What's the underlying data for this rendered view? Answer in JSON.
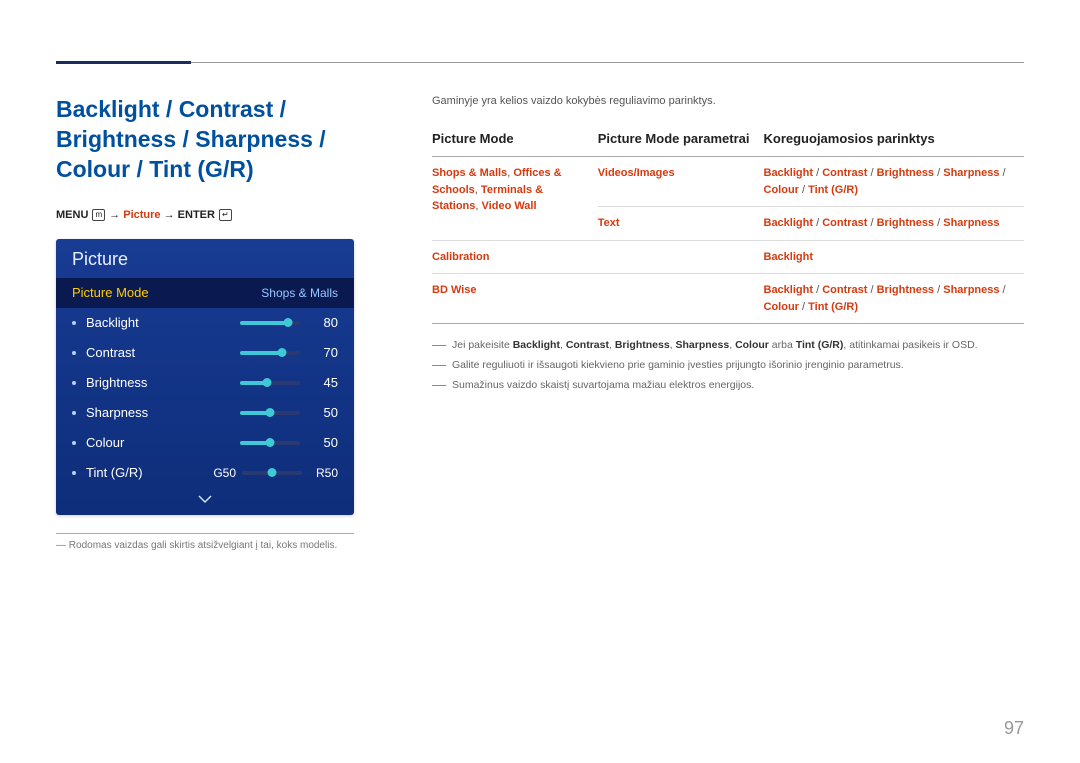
{
  "page_number": "97",
  "main_title": "Backlight / Contrast / Brightness / Sharpness / Colour / Tint (G/R)",
  "menu_path": {
    "prefix": "MENU",
    "mid": "Picture",
    "suffix": "ENTER"
  },
  "osd": {
    "title": "Picture",
    "highlight_label": "Picture Mode",
    "highlight_value": "Shops & Malls",
    "rows": [
      {
        "label": "Backlight",
        "value": "80",
        "pct": 80
      },
      {
        "label": "Contrast",
        "value": "70",
        "pct": 70
      },
      {
        "label": "Brightness",
        "value": "45",
        "pct": 45
      },
      {
        "label": "Sharpness",
        "value": "50",
        "pct": 50
      },
      {
        "label": "Colour",
        "value": "50",
        "pct": 50
      }
    ],
    "tint": {
      "label": "Tint (G/R)",
      "g": "G50",
      "r": "R50"
    }
  },
  "left_footnote": "Rodomas vaizdas gali skirtis atsižvelgiant į tai, koks modelis.",
  "intro": "Gaminyje yra kelios vaizdo kokybės reguliavimo parinktys.",
  "table": {
    "headers": {
      "mode": "Picture Mode",
      "param": "Picture Mode parametrai",
      "adj": "Koreguojamosios parinktys"
    },
    "rows": [
      {
        "mode_parts": [
          "Shops & Malls",
          ", ",
          "Offices & Schools",
          ", ",
          "Terminals & Stations",
          ", ",
          "Video Wall"
        ],
        "param_parts": [
          "Videos/Images"
        ],
        "adj_parts": [
          "Backlight",
          " / ",
          "Contrast",
          " / ",
          "Brightness",
          " / ",
          "Sharpness",
          " / ",
          "Colour",
          " / ",
          "Tint (G/R)"
        ]
      },
      {
        "mode_parts": [],
        "param_parts": [
          "Text"
        ],
        "adj_parts": [
          "Backlight",
          " / ",
          "Contrast",
          " / ",
          "Brightness",
          " / ",
          "Sharpness"
        ]
      },
      {
        "mode_parts": [
          "Calibration"
        ],
        "param_parts": [],
        "adj_parts": [
          "Backlight"
        ]
      },
      {
        "mode_parts": [
          "BD Wise"
        ],
        "param_parts": [],
        "adj_parts": [
          "Backlight",
          " / ",
          "Contrast",
          " / ",
          "Brightness",
          " / ",
          "Sharpness",
          " / ",
          "Colour",
          " / ",
          "Tint (G/R)"
        ]
      }
    ]
  },
  "notes": [
    {
      "pre": "Jei pakeisite ",
      "bold_items": [
        "Backlight",
        "Contrast",
        "Brightness",
        "Sharpness",
        "Colour"
      ],
      "mid1": " arba ",
      "bold_last": "Tint (G/R)",
      "post": ", atitinkamai pasikeis ir OSD."
    },
    {
      "plain": "Galite reguliuoti ir išsaugoti kiekvieno prie gaminio įvesties prijungto išorinio įrenginio parametrus."
    },
    {
      "plain": "Sumažinus vaizdo skaistį suvartojama mažiau elektros energijos."
    }
  ]
}
